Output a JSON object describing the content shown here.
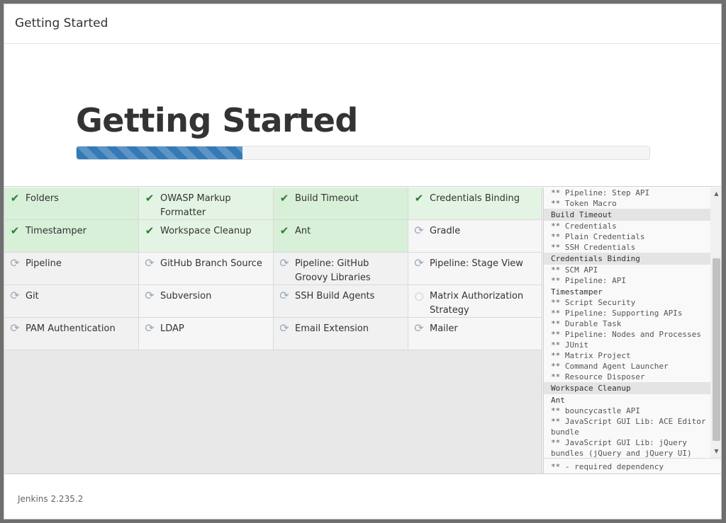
{
  "dialog": {
    "title": "Getting Started"
  },
  "hero": {
    "title": "Getting Started",
    "progress": 0.29
  },
  "plugins": [
    {
      "name": "Folders",
      "status": "installed"
    },
    {
      "name": "OWASP Markup Formatter",
      "status": "installed"
    },
    {
      "name": "Build Timeout",
      "status": "installed"
    },
    {
      "name": "Credentials Binding",
      "status": "installed"
    },
    {
      "name": "Timestamper",
      "status": "installed"
    },
    {
      "name": "Workspace Cleanup",
      "status": "installed"
    },
    {
      "name": "Ant",
      "status": "installed"
    },
    {
      "name": "Gradle",
      "status": "pending"
    },
    {
      "name": "Pipeline",
      "status": "pending"
    },
    {
      "name": "GitHub Branch Source",
      "status": "pending"
    },
    {
      "name": "Pipeline: GitHub Groovy Libraries",
      "status": "pending"
    },
    {
      "name": "Pipeline: Stage View",
      "status": "pending"
    },
    {
      "name": "Git",
      "status": "pending"
    },
    {
      "name": "Subversion",
      "status": "pending"
    },
    {
      "name": "SSH Build Agents",
      "status": "pending"
    },
    {
      "name": "Matrix Authorization Strategy",
      "status": "not-started"
    },
    {
      "name": "PAM Authentication",
      "status": "pending"
    },
    {
      "name": "LDAP",
      "status": "pending"
    },
    {
      "name": "Email Extension",
      "status": "pending"
    },
    {
      "name": "Mailer",
      "status": "pending"
    }
  ],
  "log": [
    {
      "text": "** Pipeline: Step API",
      "kind": "dep"
    },
    {
      "text": "** Token Macro",
      "kind": "dep"
    },
    {
      "text": "Build Timeout",
      "kind": "head"
    },
    {
      "text": "** Credentials",
      "kind": "dep"
    },
    {
      "text": "** Plain Credentials",
      "kind": "dep"
    },
    {
      "text": "** SSH Credentials",
      "kind": "dep"
    },
    {
      "text": "Credentials Binding",
      "kind": "head"
    },
    {
      "text": "** SCM API",
      "kind": "dep"
    },
    {
      "text": "** Pipeline: API",
      "kind": "dep"
    },
    {
      "text": "Timestamper",
      "kind": "plain"
    },
    {
      "text": "** Script Security",
      "kind": "dep"
    },
    {
      "text": "** Pipeline: Supporting APIs",
      "kind": "dep"
    },
    {
      "text": "** Durable Task",
      "kind": "dep"
    },
    {
      "text": "** Pipeline: Nodes and Processes",
      "kind": "dep"
    },
    {
      "text": "** JUnit",
      "kind": "dep"
    },
    {
      "text": "** Matrix Project",
      "kind": "dep"
    },
    {
      "text": "** Command Agent Launcher",
      "kind": "dep"
    },
    {
      "text": "** Resource Disposer",
      "kind": "dep"
    },
    {
      "text": "Workspace Cleanup",
      "kind": "head"
    },
    {
      "text": "Ant",
      "kind": "plain"
    },
    {
      "text": "** bouncycastle API",
      "kind": "dep"
    },
    {
      "text": "** JavaScript GUI Lib: ACE Editor bundle",
      "kind": "dep"
    },
    {
      "text": "** JavaScript GUI Lib: jQuery bundles (jQuery and jQuery UI)",
      "kind": "dep"
    }
  ],
  "legend": "** - required dependency",
  "footer": {
    "version": "Jenkins 2.235.2"
  },
  "colors": {
    "accent": "#337ab7",
    "installed": "#d8efd8",
    "check": "#2e7d32"
  }
}
